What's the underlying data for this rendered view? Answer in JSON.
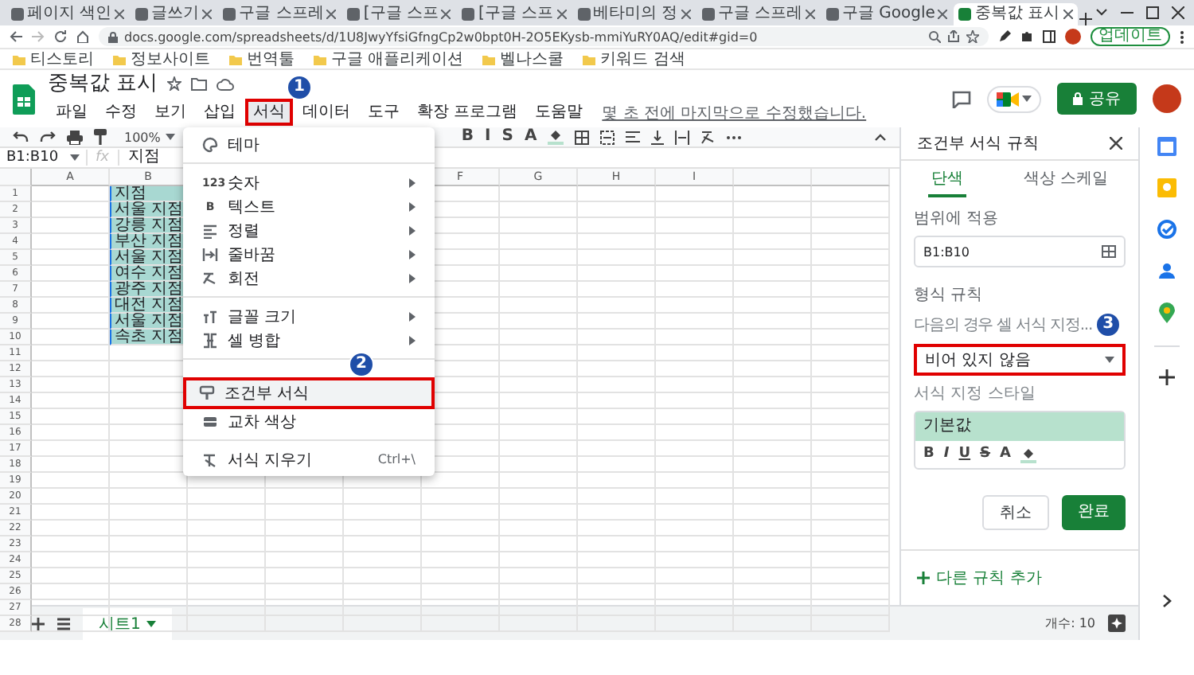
{
  "browser": {
    "tabs": [
      {
        "title": "페이지 색인",
        "selected": false
      },
      {
        "title": "글쓰기",
        "selected": false
      },
      {
        "title": "구글 스프레",
        "selected": false
      },
      {
        "title": "[구글 스프",
        "selected": false
      },
      {
        "title": "[구글 스프",
        "selected": false
      },
      {
        "title": "베타미의 정",
        "selected": false
      },
      {
        "title": "구글 스프레",
        "selected": false
      },
      {
        "title": "구글 Google",
        "selected": false
      },
      {
        "title": "중복값 표시",
        "selected": true
      }
    ],
    "url": "docs.google.com/spreadsheets/d/1U8JwyYfsiGfngCp2w0bpt0H-2O5EKysb-mmiYuRY0AQ/edit#gid=0",
    "update_button": "업데이트",
    "bookmarks": [
      "티스토리",
      "정보사이트",
      "번역툴",
      "구글 애플리케이션",
      "벨나스쿨",
      "키워드 검색"
    ]
  },
  "document": {
    "title": "중복값 표시",
    "menu": [
      {
        "label": "파일",
        "selected": false,
        "boxed": false
      },
      {
        "label": "수정",
        "selected": false,
        "boxed": false
      },
      {
        "label": "보기",
        "selected": false,
        "boxed": false
      },
      {
        "label": "삽입",
        "selected": false,
        "boxed": false
      },
      {
        "label": "서식",
        "selected": true,
        "boxed": true,
        "callout": "1"
      },
      {
        "label": "데이터",
        "selected": false,
        "boxed": false
      },
      {
        "label": "도구",
        "selected": false,
        "boxed": false
      },
      {
        "label": "확장 프로그램",
        "selected": false,
        "boxed": false
      },
      {
        "label": "도움말",
        "selected": false,
        "boxed": false
      }
    ],
    "last_edit": "몇 초 전에 마지막으로 수정했습니다.",
    "share_button": "공유"
  },
  "toolbar": {
    "zoom": "100%",
    "text_buttons": [
      "B",
      "I",
      "S",
      "A"
    ]
  },
  "formula_bar": {
    "name_box": "B1:B10",
    "fx": "fx",
    "value": "지점"
  },
  "sheet": {
    "columns": [
      "A",
      "B",
      null,
      null,
      null,
      "F",
      "G",
      "H",
      "I",
      null,
      null
    ],
    "rows": [
      {
        "number": "1",
        "b": "지점",
        "selected": true
      },
      {
        "number": "2",
        "b": "서울 지점",
        "selected": true
      },
      {
        "number": "3",
        "b": "강릉 지점",
        "selected": true
      },
      {
        "number": "4",
        "b": "부산 지점",
        "selected": true
      },
      {
        "number": "5",
        "b": "서울 지점",
        "selected": true
      },
      {
        "number": "6",
        "b": "여수 지점",
        "selected": true
      },
      {
        "number": "7",
        "b": "광주 지점",
        "selected": true
      },
      {
        "number": "8",
        "b": "대전 지점",
        "selected": true
      },
      {
        "number": "9",
        "b": "서울 지점",
        "selected": true
      },
      {
        "number": "10",
        "b": "속초 지점",
        "selected": true
      },
      {
        "number": "11",
        "selected": false
      },
      {
        "number": "12",
        "selected": false
      },
      {
        "number": "13",
        "selected": false
      },
      {
        "number": "14",
        "selected": false
      },
      {
        "number": "15",
        "selected": false
      },
      {
        "number": "16",
        "selected": false
      },
      {
        "number": "17",
        "selected": false
      },
      {
        "number": "18",
        "selected": false
      },
      {
        "number": "19",
        "selected": false
      },
      {
        "number": "20",
        "selected": false
      },
      {
        "number": "21",
        "selected": false
      },
      {
        "number": "22",
        "selected": false
      },
      {
        "number": "23",
        "selected": false
      },
      {
        "number": "24",
        "selected": false
      },
      {
        "number": "25",
        "selected": false
      },
      {
        "number": "26",
        "selected": false
      },
      {
        "number": "27",
        "selected": false
      },
      {
        "number": "28",
        "selected": false
      }
    ]
  },
  "format_menu": {
    "items": [
      {
        "kind": "item",
        "label": "테마",
        "submenu": false,
        "highlighted": false,
        "boxed": false
      },
      {
        "kind": "divider"
      },
      {
        "kind": "item",
        "glyph": "123",
        "label": "숫자",
        "submenu": true,
        "highlighted": false,
        "boxed": false
      },
      {
        "kind": "item",
        "glyph": "B",
        "label": "텍스트",
        "submenu": true,
        "highlighted": false,
        "boxed": false
      },
      {
        "kind": "item",
        "label": "정렬",
        "submenu": true,
        "highlighted": false,
        "boxed": false
      },
      {
        "kind": "item",
        "label": "줄바꿈",
        "submenu": true,
        "highlighted": false,
        "boxed": false
      },
      {
        "kind": "item",
        "label": "회전",
        "submenu": true,
        "highlighted": false,
        "boxed": false
      },
      {
        "kind": "divider"
      },
      {
        "kind": "item",
        "label": "글꼴 크기",
        "submenu": true,
        "highlighted": false,
        "boxed": false
      },
      {
        "kind": "item",
        "label": "셀 병합",
        "submenu": true,
        "highlighted": false,
        "boxed": false
      },
      {
        "kind": "divider"
      },
      {
        "kind": "item",
        "label": "조건부 서식",
        "submenu": false,
        "highlighted": true,
        "boxed": true,
        "callout": "2"
      },
      {
        "kind": "item",
        "label": "교차 색상",
        "submenu": false,
        "highlighted": false,
        "boxed": false
      },
      {
        "kind": "divider"
      },
      {
        "kind": "item",
        "label": "서식 지우기",
        "shortcut": "Ctrl+\\",
        "submenu": false,
        "highlighted": false,
        "boxed": false
      }
    ]
  },
  "side_panel": {
    "title": "조건부 서식 규칙",
    "tabs": [
      {
        "label": "단색",
        "selected": true
      },
      {
        "label": "색상 스케일",
        "selected": false
      }
    ],
    "range_label": "범위에 적용",
    "range_value": "B1:B10",
    "rules_label": "형식 규칙",
    "condition_label": "다음의 경우 셀 서식 지정...",
    "condition": {
      "value": "비어 있지 않음",
      "boxed": true,
      "callout": "3"
    },
    "style_label": "서식 지정 스타일",
    "style_preview": "기본값",
    "style_buttons": [
      "B",
      "I",
      "U",
      "S",
      "A"
    ],
    "cancel_button": "취소",
    "done_button": "완료",
    "add_rule": "다른 규칙 추가"
  },
  "bottom_bar": {
    "sheet_tabs": [
      {
        "label": "시트1",
        "selected": true
      }
    ],
    "count": "개수: 10"
  }
}
